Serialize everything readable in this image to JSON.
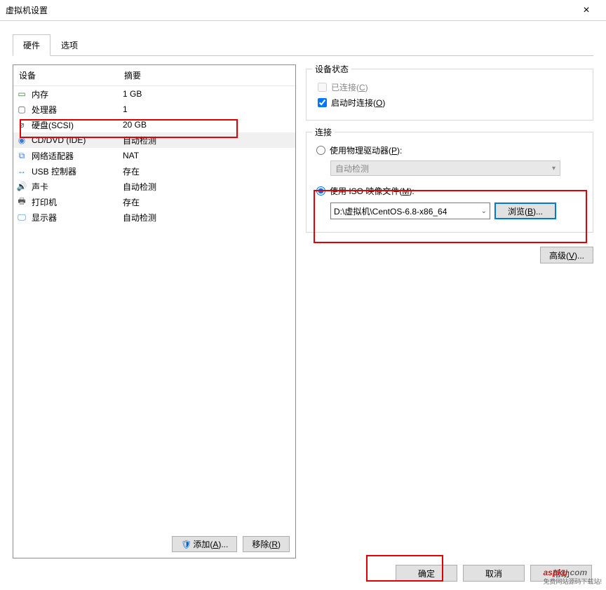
{
  "window": {
    "title": "虚拟机设置",
    "close": "×"
  },
  "tabs": {
    "hardware": "硬件",
    "options": "选项"
  },
  "list": {
    "header": {
      "device": "设备",
      "summary": "摘要"
    },
    "rows": [
      {
        "icon": "memory-icon",
        "name": "内存",
        "summary": "1 GB"
      },
      {
        "icon": "cpu-icon",
        "name": "处理器",
        "summary": "1"
      },
      {
        "icon": "disk-icon",
        "name": "硬盘(SCSI)",
        "summary": "20 GB"
      },
      {
        "icon": "cd-icon",
        "name": "CD/DVD (IDE)",
        "summary": "自动检测"
      },
      {
        "icon": "net-icon",
        "name": "网络适配器",
        "summary": "NAT"
      },
      {
        "icon": "usb-icon",
        "name": "USB 控制器",
        "summary": "存在"
      },
      {
        "icon": "sound-icon",
        "name": "声卡",
        "summary": "自动检测"
      },
      {
        "icon": "printer-icon",
        "name": "打印机",
        "summary": "存在"
      },
      {
        "icon": "display-icon",
        "name": "显示器",
        "summary": "自动检测"
      }
    ],
    "add": "添加(",
    "add_u": "A",
    "add_end": ")...",
    "remove": "移除(",
    "remove_u": "R",
    "remove_end": ")"
  },
  "status": {
    "legend": "设备状态",
    "connected": "已连接(",
    "connected_u": "C",
    "connected_end": ")",
    "connect_at_power": "启动时连接(",
    "connect_at_power_u": "O",
    "connect_at_power_end": ")"
  },
  "connection": {
    "legend": "连接",
    "physical": "使用物理驱动器(",
    "physical_u": "P",
    "physical_end": "):",
    "physical_value": "自动检测",
    "iso": "使用 ISO 映像文件(",
    "iso_u": "M",
    "iso_end": "):",
    "iso_path": "D:\\虚拟机\\CentOS-6.8-x86_64",
    "browse": "浏览(",
    "browse_u": "B",
    "browse_end": "..."
  },
  "advanced": {
    "label": "高级(",
    "label_u": "V",
    "label_end": ")..."
  },
  "buttons": {
    "ok": "确定",
    "cancel": "取消",
    "help": "帮助"
  },
  "watermark": {
    "main": "aspku",
    "dom": ".com",
    "sub": "免费网站源码下载站!"
  }
}
